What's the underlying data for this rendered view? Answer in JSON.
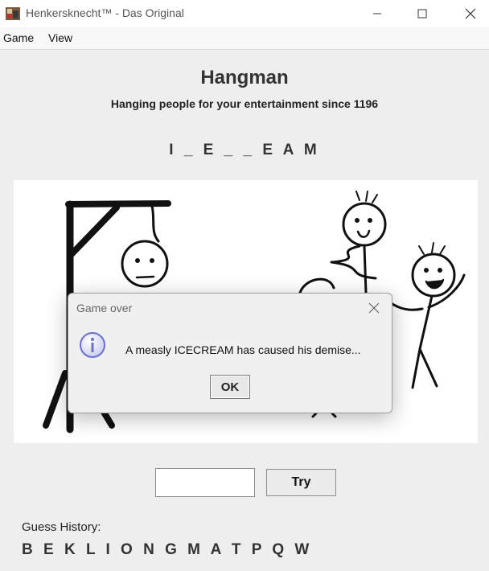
{
  "window": {
    "title": "Henkersknecht™ - Das Original",
    "controls": {
      "minimize_icon": "minimize-icon",
      "maximize_icon": "maximize-icon",
      "close_icon": "close-icon"
    }
  },
  "menu": {
    "items": [
      "Game",
      "View"
    ]
  },
  "main": {
    "title": "Hangman",
    "subtitle": "Hanging people for your entertainment since 1196",
    "word_display": "I_E__EAM"
  },
  "scene": {
    "image": "hangman-drawing-with-stick-figure-spectators"
  },
  "dialog": {
    "title": "Game over",
    "message": "A measly ICECREAM has caused his demise...",
    "ok_label": "OK",
    "icon": "info-icon",
    "close_icon": "close-icon"
  },
  "guess": {
    "input_value": "",
    "try_label": "Try"
  },
  "history": {
    "label": "Guess History:",
    "letters": "BEKLIONGMATPQW"
  },
  "colors": {
    "background": "#eeeeee",
    "canvas": "#ffffff",
    "dialog_bg": "#f0f0f0",
    "info_icon": "#6b6fcf"
  }
}
